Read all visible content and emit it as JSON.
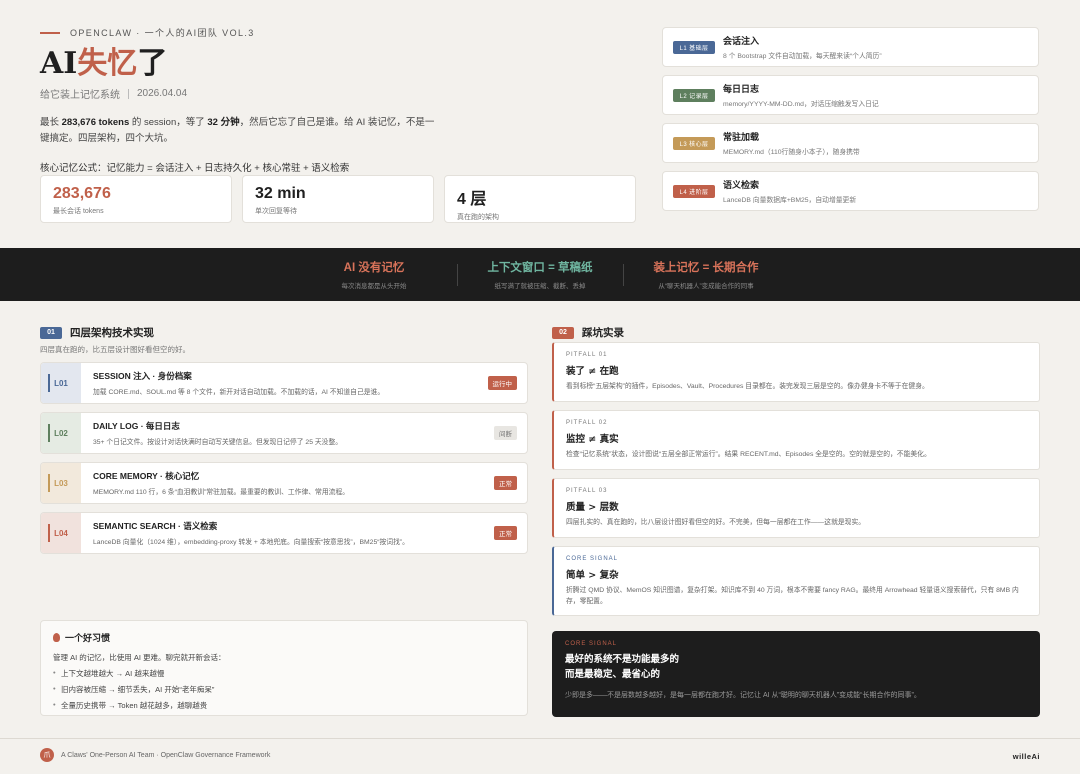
{
  "colors": {
    "accent": "#c0604a",
    "blue": "#4a6896",
    "green": "#5e7f5e",
    "gold": "#c49a58",
    "dark": "#1d1d1d"
  },
  "hero": {
    "kicker": "OPENCLAW · 一个人的AI团队 VOL.3",
    "title_pre": "AI",
    "title_accent": "失忆",
    "title_post": "了",
    "subtitle": "给它装上记忆系统",
    "date": "2026.04.04",
    "desc_1": "最长 ",
    "desc_tokens": "283,676 tokens",
    "desc_2": " 的 session，等了 ",
    "desc_min": "32 分钟",
    "desc_3": "，然后它忘了自己是谁。给 AI 装记忆，不是一键搞定。四层架构，四个大坑。",
    "formula": "核心记忆公式：记忆能力 = 会话注入 + 日志持久化 + 核心常驻 + 语义检索"
  },
  "stats": [
    {
      "num": "283,676",
      "label": "最长会话 tokens"
    },
    {
      "num": "32 min",
      "label": "单次回复等待"
    },
    {
      "num": "4 层",
      "label": "真在跑的架构"
    }
  ],
  "layers": [
    {
      "tag": "L1 基础层",
      "title": "会话注入",
      "desc": "8 个 Bootstrap 文件自动加载，每天醒来读“个人简历”"
    },
    {
      "tag": "L2 记录层",
      "title": "每日日志",
      "desc": "memory/YYYY-MM-DD.md，对话压缩触发写入日记"
    },
    {
      "tag": "L3 核心层",
      "title": "常驻加载",
      "desc": "MEMORY.md（110行随身小本子），随身携带"
    },
    {
      "tag": "L4 进阶层",
      "title": "语义检索",
      "desc": "LanceDB 向量数据库+BM25，自动增量更新"
    }
  ],
  "band": [
    {
      "title": "AI 没有记忆",
      "sub": "每次消息都是从头开始"
    },
    {
      "title": "上下文窗口 = 草稿纸",
      "sub": "纸写满了就被压缩、截断、丢掉"
    },
    {
      "title": "装上记忆 = 长期合作",
      "sub": "从“聊天机器人”变成能合作的同事"
    }
  ],
  "section1": {
    "num": "01",
    "title": "四层架构技术实现",
    "sub": "四层真在跑的，比五层设计图好看但空的好。"
  },
  "section2": {
    "num": "02",
    "title": "踩坑实录"
  },
  "rows": [
    {
      "code": "L01",
      "title": "SESSION 注入 · 身份档案",
      "desc": "加载 CORE.md、SOUL.md 等 8 个文件，新开对话自动加载。不加载的话，AI 不知道自己是谁。",
      "status": "运行中"
    },
    {
      "code": "L02",
      "title": "DAILY LOG · 每日日志",
      "desc": "35+ 个日记文件。按设计对话快满时自动写关键信息。但发现日记停了 25 天没整。",
      "status": "间断"
    },
    {
      "code": "L03",
      "title": "CORE MEMORY · 核心记忆",
      "desc": "MEMORY.md 110 行，6 条“血泪教训”常驻加载。最重要的教训、工作律、常用流程。",
      "status": "正常"
    },
    {
      "code": "L04",
      "title": "SEMANTIC SEARCH · 语义检索",
      "desc": "LanceDB 向量化（1024 维），embedding-proxy 转发 + 本地兜底。向量搜索“按意思找”，BM25“按词找”。",
      "status": "正常"
    }
  ],
  "habit": {
    "title": "一个好习惯",
    "desc": "管理 AI 的记忆，比使用 AI 更难。聊完就开新会话：",
    "items": [
      "上下文越堆越大 → AI 越来越慢",
      "旧内容被压缩 → 细节丢失，AI 开始“老年痴呆”",
      "全量历史携带 → Token 越花越多，越聊越贵"
    ]
  },
  "pitfalls": [
    {
      "label": "PITFALL 01",
      "title": "装了 ≠ 在跑",
      "desc": "看到标榜“五层架构”的插件，Episodes、Vault、Procedures 目录都在。装完发现三层是空的。像办健身卡不等于在健身。"
    },
    {
      "label": "PITFALL 02",
      "title": "监控 ≠ 真实",
      "desc": "检查“记忆系统”状态，设计图说“五层全部正常运行”。结果 RECENT.md、Episodes 全是空的。空的就是空的，不能美化。"
    },
    {
      "label": "PITFALL 03",
      "title": "质量 > 层数",
      "desc": "四层扎实的、真在跑的，比八层设计图好看但空的好。不完美，但每一层都在工作——这就是现实。"
    },
    {
      "label": "CORE SIGNAL",
      "title": "简单 > 复杂",
      "desc": "折腾过 QMD 协议、MemOS 知识图谱，复杂打架。知识库不到 40 万词，根本不需要 fancy RAG。最终用 Arrowhead 轻量语义搜索替代，只有 8MB 内存，零配置。"
    }
  ],
  "dark_signal": {
    "label": "CORE SIGNAL",
    "title_1": "最好的系统不是功能最多的",
    "title_2": "而是最稳定、最省心的",
    "desc": "少即是多——不是层数越多越好，是每一层都在跑才好。记忆让 AI 从“聪明的聊天机器人”变成能“长期合作的同事”。"
  },
  "footer": {
    "logo": "爪",
    "text": "A Claws' One-Person AI Team · OpenClaw Governance Framework",
    "brand": "willeAi"
  }
}
